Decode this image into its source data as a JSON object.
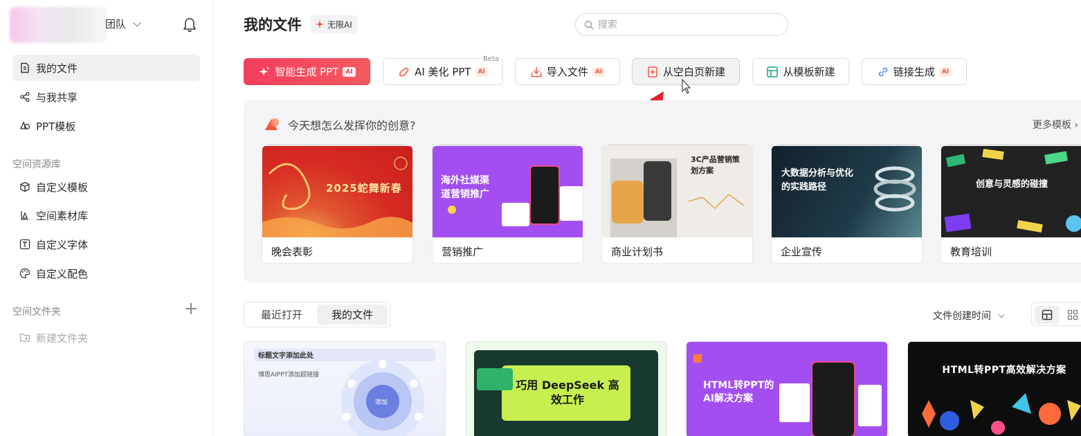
{
  "sidebar": {
    "team_name": "团队",
    "items": [
      {
        "label": "我的文件",
        "icon": "file-icon"
      },
      {
        "label": "与我共享",
        "icon": "share-icon"
      },
      {
        "label": "PPT模板",
        "icon": "template-icon"
      }
    ],
    "space_library_label": "空间资源库",
    "library_items": [
      {
        "label": "自定义模板",
        "icon": "cube-icon"
      },
      {
        "label": "空间素材库",
        "icon": "assets-icon"
      },
      {
        "label": "自定义字体",
        "icon": "font-icon"
      },
      {
        "label": "自定义配色",
        "icon": "palette-icon"
      }
    ],
    "space_folder_label": "空间文件夹",
    "new_folder_label": "新建文件夹"
  },
  "header": {
    "title": "我的文件",
    "ai_chip": "无限AI",
    "search_placeholder": "搜索"
  },
  "actions": {
    "smart_generate": "智能生成 PPT",
    "ai_beautify": "AI 美化 PPT",
    "beta": "Beta",
    "import_file": "导入文件",
    "blank_new": "从空白页新建",
    "template_new": "从模板新建",
    "link_generate": "链接生成",
    "ai_tag": "AI"
  },
  "templates": {
    "question": "今天想怎么发挥你的创意?",
    "more": "更多模板 ›",
    "cards": [
      {
        "caption": "晚会表彰",
        "thumb_text": "2025蛇舞新春"
      },
      {
        "caption": "营销推广",
        "thumb_text": "海外社媒渠道营销推广"
      },
      {
        "caption": "商业计划书",
        "thumb_text": "3C产品营销策划方案"
      },
      {
        "caption": "企业宣传",
        "thumb_text": "大数据分析与优化的实践路径"
      },
      {
        "caption": "教育培训",
        "thumb_text": "创意与灵感的碰撞"
      }
    ]
  },
  "files": {
    "tabs": [
      "最近打开",
      "我的文件"
    ],
    "active_tab": 1,
    "sort_label": "文件创建时间",
    "cards": [
      {
        "title": "标题文字添加此处",
        "subtitle": "博思AIPPT添加超链接",
        "center": "添加"
      },
      {
        "title": "巧用 DeepSeek 高效工作"
      },
      {
        "title": "HTML转PPT的AI解决方案"
      },
      {
        "title": "HTML转PPT高效解决方案"
      }
    ]
  },
  "colors": {
    "primary": "#f33d5d",
    "ai_tag": "#f2553e"
  }
}
